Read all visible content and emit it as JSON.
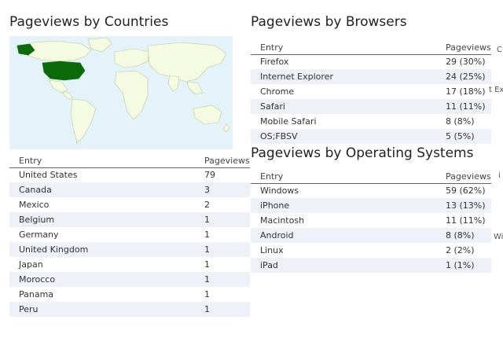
{
  "countries": {
    "title": "Pageviews by Countries",
    "columns": [
      "Entry",
      "Pageviews"
    ],
    "rows": [
      [
        "United States",
        "79"
      ],
      [
        "Canada",
        "3"
      ],
      [
        "Mexico",
        "2"
      ],
      [
        "Belgium",
        "1"
      ],
      [
        "Germany",
        "1"
      ],
      [
        "United Kingdom",
        "1"
      ],
      [
        "Japan",
        "1"
      ],
      [
        "Morocco",
        "1"
      ],
      [
        "Panama",
        "1"
      ],
      [
        "Peru",
        "1"
      ]
    ],
    "map_colors": {
      "ocean": "#e4f2fa",
      "land": "#f5fbe0",
      "highlight": "#0b6b0b",
      "border": "#b9c9a0"
    }
  },
  "browsers": {
    "title": "Pageviews by Browsers",
    "columns": [
      "Entry",
      "Pageviews"
    ],
    "rows": [
      [
        "Firefox",
        "29 (30%)"
      ],
      [
        "Internet Explorer",
        "24 (25%)"
      ],
      [
        "Chrome",
        "17 (18%)"
      ],
      [
        "Safari",
        "11 (11%)"
      ],
      [
        "Mobile Safari",
        "8 (8%)"
      ],
      [
        "OS;FBSV",
        "5 (5%)"
      ]
    ]
  },
  "os": {
    "title": "Pageviews by Operating Systems",
    "columns": [
      "Entry",
      "Pageviews"
    ],
    "rows": [
      [
        "Windows",
        "59 (62%)"
      ],
      [
        "iPhone",
        "13 (13%)"
      ],
      [
        "Macintosh",
        "11 (11%)"
      ],
      [
        "Android",
        "8 (8%)"
      ],
      [
        "Linux",
        "2 (2%)"
      ],
      [
        "iPad",
        "1 (1%)"
      ]
    ]
  },
  "clipped_right": [
    "C",
    "t Ex",
    "i",
    "Wi"
  ]
}
